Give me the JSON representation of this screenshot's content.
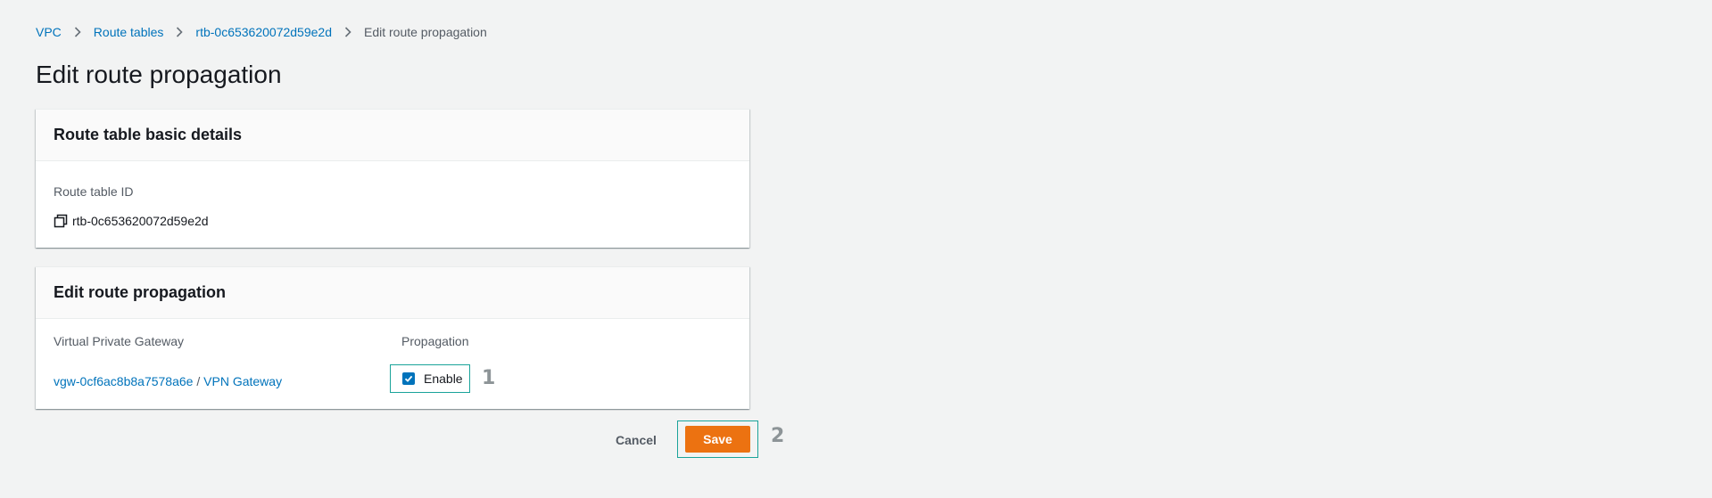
{
  "breadcrumb": {
    "items": [
      "VPC",
      "Route tables",
      "rtb-0c653620072d59e2d"
    ],
    "current": "Edit route propagation"
  },
  "page": {
    "title": "Edit route propagation"
  },
  "basic_details": {
    "heading": "Route table basic details",
    "route_table_id_label": "Route table ID",
    "route_table_id_value": "rtb-0c653620072d59e2d"
  },
  "propagation_panel": {
    "heading": "Edit route propagation",
    "col_gateway": "Virtual Private Gateway",
    "col_propagation": "Propagation",
    "gateway_id": "vgw-0cf6ac8b8a7578a6e",
    "gateway_separator": " / ",
    "gateway_name": "VPN Gateway",
    "enable_label": "Enable",
    "enable_checked": true
  },
  "actions": {
    "cancel_label": "Cancel",
    "save_label": "Save"
  },
  "annotations": {
    "step1": "1",
    "step2": "2"
  },
  "colors": {
    "link": "#0073bb",
    "primary_button": "#ec7211",
    "highlight_border": "#1aa39a",
    "background": "#f2f3f3"
  },
  "icons": [
    "chevron-right-icon",
    "copy-icon",
    "checkmark-icon"
  ]
}
